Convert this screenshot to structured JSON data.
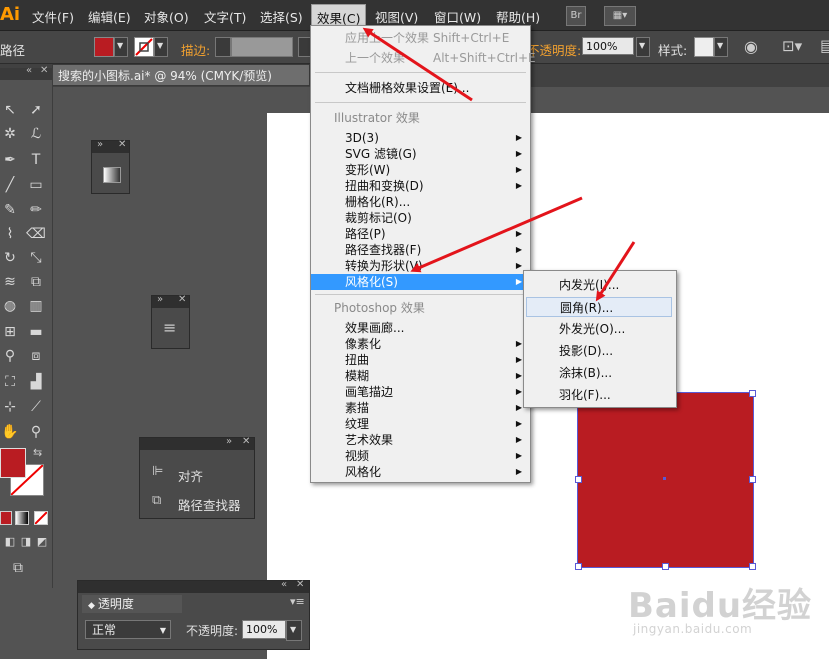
{
  "menubar": {
    "logo": "Ai",
    "items": [
      "文件(F)",
      "编辑(E)",
      "对象(O)",
      "文字(T)",
      "选择(S)",
      "效果(C)",
      "视图(V)",
      "窗口(W)",
      "帮助(H)"
    ],
    "bridge_label": "Br"
  },
  "controlbar": {
    "path_label": "路径",
    "stroke_label": "描边:",
    "opacity_label": "不透明度:",
    "opacity_value": "100%",
    "style_label": "样式:",
    "fill_color": "#b91c22"
  },
  "document_tab": "搜索的小图标.ai* @ 94% (CMYK/预览)",
  "effect_menu": {
    "apply_last": "应用上一个效果",
    "apply_last_shortcut": "Shift+Ctrl+E",
    "last_effect": "上一个效果",
    "last_effect_shortcut": "Alt+Shift+Ctrl+E",
    "raster_settings": "文档栅格效果设置(E)...",
    "illustrator_header": "Illustrator 效果",
    "illustrator_items": [
      "3D(3)",
      "SVG 滤镜(G)",
      "变形(W)",
      "扭曲和变换(D)",
      "栅格化(R)...",
      "裁剪标记(O)",
      "路径(P)",
      "路径查找器(F)",
      "转换为形状(V)",
      "风格化(S)"
    ],
    "photoshop_header": "Photoshop 效果",
    "photoshop_items": [
      "效果画廊...",
      "像素化",
      "扭曲",
      "模糊",
      "画笔描边",
      "素描",
      "纹理",
      "艺术效果",
      "视频",
      "风格化"
    ]
  },
  "stylize_submenu": {
    "items": [
      "内发光(I)...",
      "圆角(R)...",
      "外发光(O)...",
      "投影(D)...",
      "涂抹(B)...",
      "羽化(F)..."
    ]
  },
  "panels": {
    "align_label": "对齐",
    "pathfinder_label": "路径查找器"
  },
  "transparency_panel": {
    "tab": "透明度",
    "blend_mode": "正常",
    "opacity_label": "不透明度:",
    "opacity_value": "100%"
  },
  "watermark": {
    "brand": "Baidu经验",
    "url": "jingyan.baidu.com"
  },
  "colors": {
    "accent_red": "#b91c22",
    "menu_highlight": "#3399ff",
    "arrow_red": "#e3141b"
  }
}
